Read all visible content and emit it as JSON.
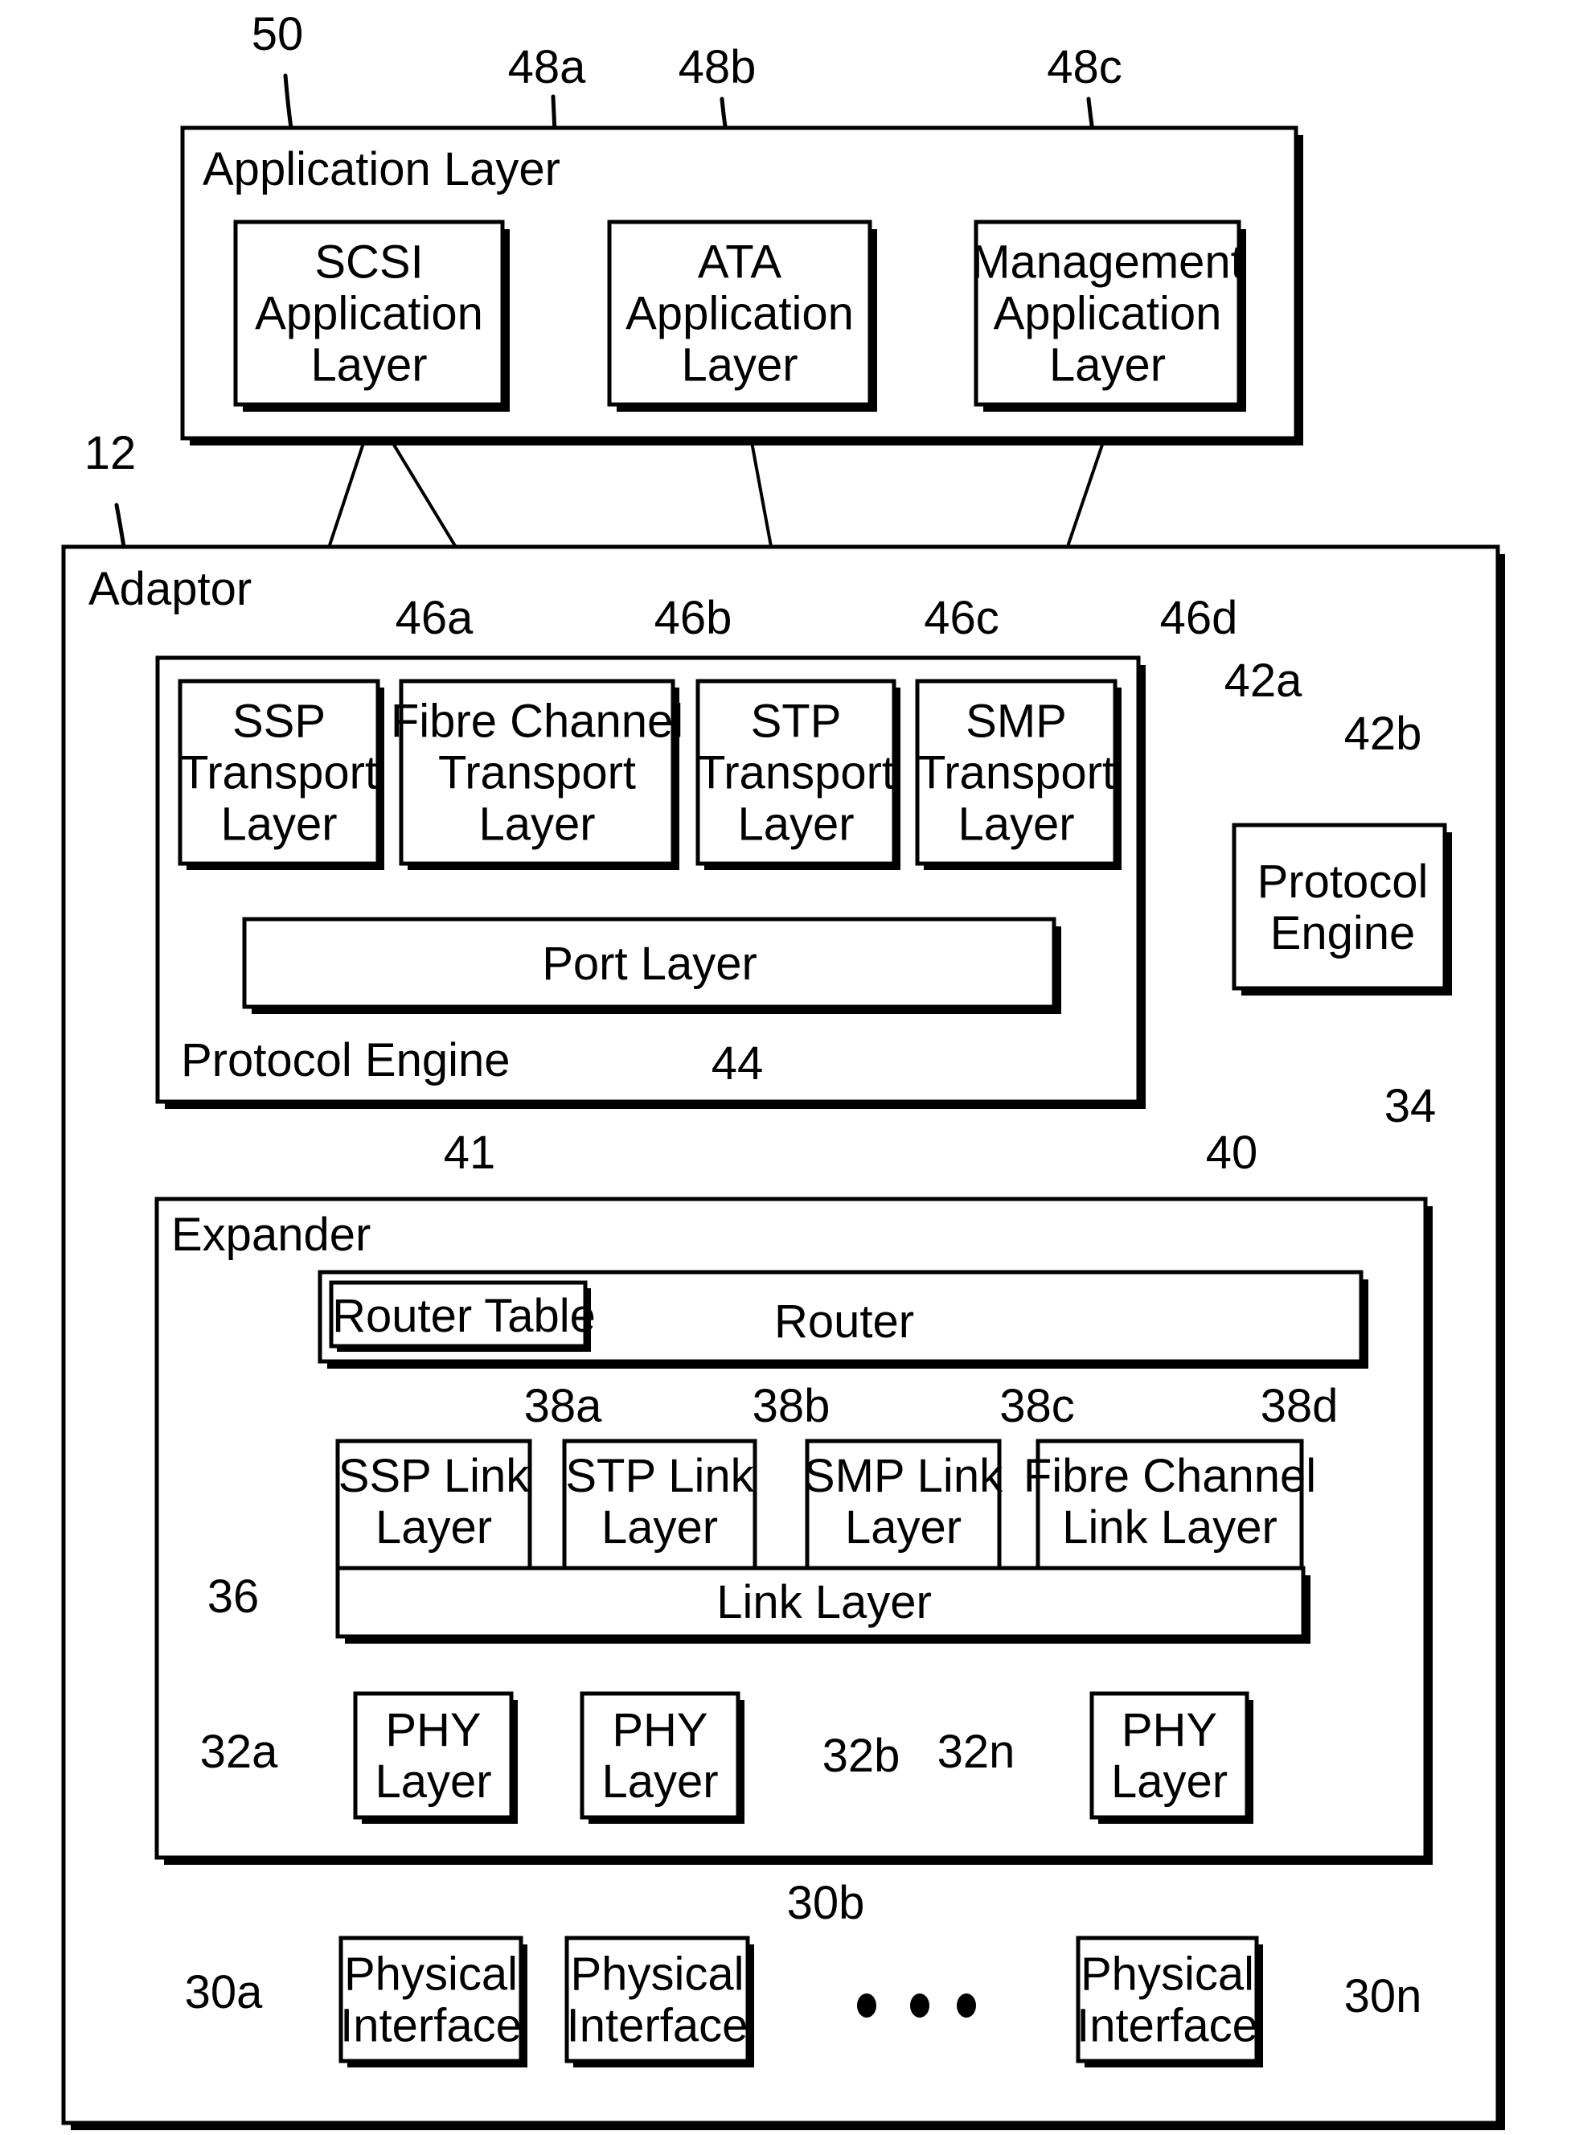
{
  "figure": {
    "application_layer": {
      "title": "Application Layer",
      "ref": "50",
      "apps": [
        {
          "lines": [
            "SCSI",
            "Application",
            "Layer"
          ],
          "ref": "48a"
        },
        {
          "lines": [
            "ATA",
            "Application",
            "Layer"
          ],
          "ref": "48b"
        },
        {
          "lines": [
            "Management",
            "Application",
            "Layer"
          ],
          "ref": "48c"
        }
      ]
    },
    "adaptor": {
      "title": "Adaptor",
      "ref": "12",
      "protocol_engine_a": {
        "title": "Protocol Engine",
        "ref": "42a",
        "transports": [
          {
            "lines": [
              "SSP",
              "Transport",
              "Layer"
            ],
            "ref": "46a"
          },
          {
            "lines": [
              "Fibre Channel",
              "Transport",
              "Layer"
            ],
            "ref": "46b"
          },
          {
            "lines": [
              "STP",
              "Transport",
              "Layer"
            ],
            "ref": "46c"
          },
          {
            "lines": [
              "SMP",
              "Transport",
              "Layer"
            ],
            "ref": "46d"
          }
        ],
        "port_layer": {
          "label": "Port Layer",
          "ref": "44"
        }
      },
      "protocol_engine_b": {
        "lines": [
          "Protocol",
          "Engine"
        ],
        "ref": "42b"
      },
      "expander": {
        "title": "Expander",
        "ref": "34",
        "router": {
          "label": "Router",
          "ref": "40"
        },
        "router_table": {
          "label": "Router Table",
          "ref": "41"
        },
        "link_layers": [
          {
            "lines": [
              "SSP Link",
              "Layer"
            ],
            "ref": "38a"
          },
          {
            "lines": [
              "STP Link",
              "Layer"
            ],
            "ref": "38b"
          },
          {
            "lines": [
              "SMP Link",
              "Layer"
            ],
            "ref": "38c"
          },
          {
            "lines": [
              "Fibre Channel",
              "Link Layer"
            ],
            "ref": "38d"
          }
        ],
        "link_layer": {
          "label": "Link Layer",
          "ref": "36"
        },
        "phys": [
          {
            "lines": [
              "PHY",
              "Layer"
            ],
            "ref": "32a"
          },
          {
            "lines": [
              "PHY",
              "Layer"
            ],
            "ref": "32b"
          },
          {
            "lines": [
              "PHY",
              "Layer"
            ],
            "ref": "32n"
          }
        ]
      },
      "physical_interfaces": [
        {
          "lines": [
            "Physical",
            "Interface"
          ],
          "ref": "30a"
        },
        {
          "lines": [
            "Physical",
            "Interface"
          ],
          "ref": "30b"
        },
        {
          "lines": [
            "Physical",
            "Interface"
          ],
          "ref": "30n"
        }
      ],
      "ellipsis": "• • •"
    }
  }
}
